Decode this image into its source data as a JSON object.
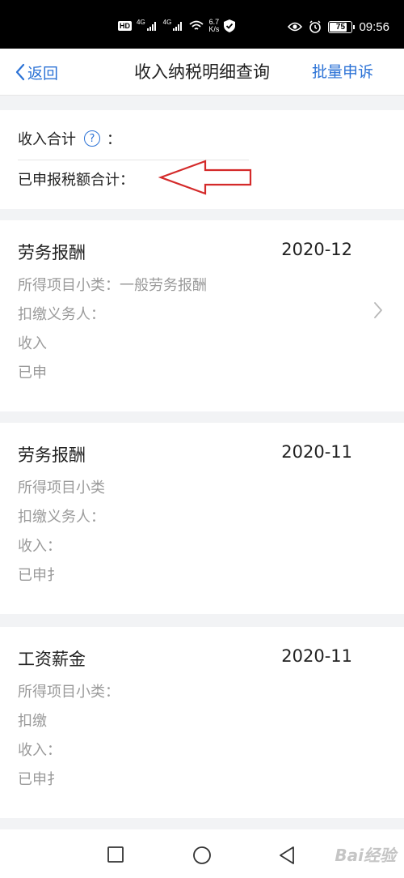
{
  "status_bar": {
    "hd": "HD",
    "net1": "4G",
    "net2": "4G",
    "speed_value": "6.7",
    "speed_unit": "K/s",
    "battery": "75",
    "time": "09:56"
  },
  "nav": {
    "back_label": "返回",
    "title": "收入纳税明细查询",
    "batch_label": "批量申诉"
  },
  "summary": {
    "income_total_label": "收入合计",
    "help_glyph": "?",
    "income_colon": "：",
    "tax_total_label": "已申报税额合计："
  },
  "cards": [
    {
      "title": "劳务报酬",
      "date": "2020-12",
      "lines": [
        "所得项目小类：一般劳务报酬",
        "扣缴义务人：",
        "收入",
        "已申"
      ]
    },
    {
      "title": "劳务报酬",
      "date": "2020-11",
      "lines": [
        "所得项目小类",
        "扣缴义务人：",
        "收入：",
        "已申扌"
      ]
    },
    {
      "title": "工资薪金",
      "date": "2020-11",
      "lines": [
        "所得项目小类：",
        "扣缴",
        "收入：",
        "已申扌"
      ]
    }
  ],
  "watermark": "Bai经验",
  "colors": {
    "accent": "#2b72d6",
    "annotation_arrow": "#d42a2a"
  }
}
